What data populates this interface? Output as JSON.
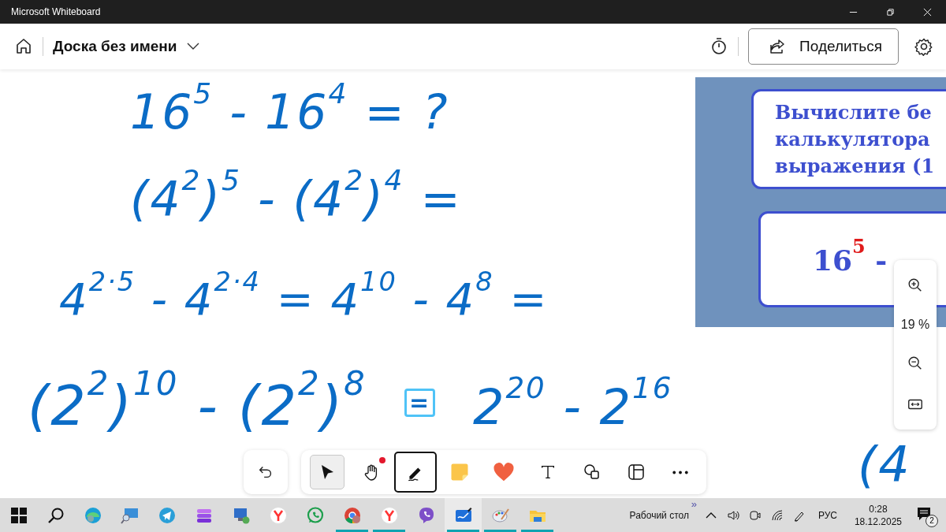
{
  "window": {
    "title": "Microsoft Whiteboard"
  },
  "header": {
    "board_title": "Доска без имени",
    "share_button": "Поделиться"
  },
  "ink": [
    {
      "text": "16$^{5}$ - 16$^{4}$ = ?",
      "selected": false
    },
    {
      "text": "(4$^{2}$)$^{5}$ - (4$^{2}$)$^{4}$ =",
      "selected": false
    },
    {
      "text": "4$^{2·5}$ - 4$^{2·4}$ = 4$^{10}$ - 4$^{8}$ =",
      "selected": false
    },
    {
      "text": "(2$^{2}$)$^{10}$ - (2$^{2}$)$^{8}$",
      "selected": false
    },
    {
      "text": "=",
      "selected": true
    },
    {
      "text": "2$^{20}$ - 2$^{16}$",
      "selected": false
    },
    {
      "text": "(4",
      "selected": false
    }
  ],
  "slide": {
    "task_lines": [
      "Вычислите бе",
      "калькулятора",
      "выражения (1"
    ],
    "expression_base": "16",
    "expression_power": "5",
    "expression_rest": " - "
  },
  "zoom": {
    "level_text": "19 %"
  },
  "toolbar": {
    "tools": [
      {
        "kind": "select",
        "hovered": true,
        "selected": false,
        "badge": false
      },
      {
        "kind": "hand",
        "hovered": false,
        "selected": false,
        "badge": true
      },
      {
        "kind": "pen",
        "hovered": false,
        "selected": true,
        "badge": false
      },
      {
        "kind": "note",
        "hovered": false,
        "selected": false,
        "badge": false
      },
      {
        "kind": "heart",
        "hovered": false,
        "selected": false,
        "badge": false
      },
      {
        "kind": "text",
        "hovered": false,
        "selected": false,
        "badge": false
      },
      {
        "kind": "shapes",
        "hovered": false,
        "selected": false,
        "badge": false
      },
      {
        "kind": "layout",
        "hovered": false,
        "selected": false,
        "badge": false
      },
      {
        "kind": "more",
        "hovered": false,
        "selected": false,
        "badge": false
      }
    ]
  },
  "taskbar": {
    "apps": [
      {
        "kind": "windows",
        "running": false,
        "active": false
      },
      {
        "kind": "search",
        "running": false,
        "active": false
      },
      {
        "kind": "edge",
        "running": false,
        "active": false
      },
      {
        "kind": "magnifier",
        "running": false,
        "active": false
      },
      {
        "kind": "telegram",
        "running": false,
        "active": false
      },
      {
        "kind": "stack",
        "running": false,
        "active": false
      },
      {
        "kind": "remote",
        "running": false,
        "active": false
      },
      {
        "kind": "yandex",
        "running": false,
        "active": false
      },
      {
        "kind": "whatsapp",
        "running": false,
        "active": false
      },
      {
        "kind": "chrome",
        "running": true,
        "active": false
      },
      {
        "kind": "yandex",
        "running": true,
        "active": false
      },
      {
        "kind": "viber",
        "running": false,
        "active": false
      },
      {
        "kind": "whiteboard",
        "running": true,
        "active": true
      },
      {
        "kind": "paint",
        "running": true,
        "active": false
      },
      {
        "kind": "explorer",
        "running": true,
        "active": false
      }
    ],
    "overflow": "»",
    "desktop": "Рабочий стол",
    "language": "РУС",
    "time": "0:28",
    "date": "18.12.2025",
    "notifications": "2"
  }
}
